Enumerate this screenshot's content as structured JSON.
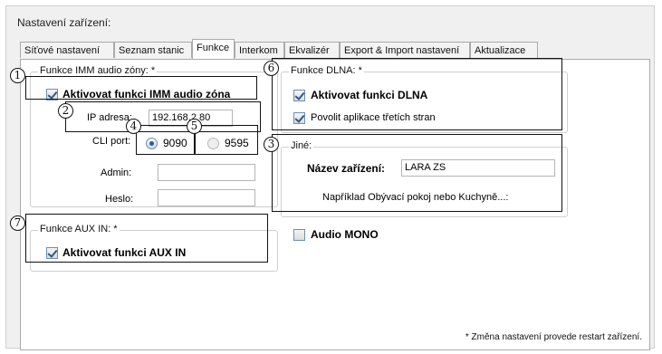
{
  "group": {
    "title": "Nastavení zařízení:"
  },
  "tabs": [
    {
      "label": "Síťové nastavení"
    },
    {
      "label": "Seznam stanic"
    },
    {
      "label": "Funkce"
    },
    {
      "label": "Interkom"
    },
    {
      "label": "Ekvalizér"
    },
    {
      "label": "Export & Import nastavení"
    },
    {
      "label": "Aktualizace"
    }
  ],
  "active_tab": "Funkce",
  "imm": {
    "legend": "Funkce IMM audio zóny: *",
    "enable_label": "Aktivovat funkci IMM audio zóna",
    "enable_checked": true,
    "ip_label": "IP adresa:",
    "ip_value": "192.168.2.80",
    "cli_label": "CLI port:",
    "port_options": [
      {
        "label": "9090",
        "selected": true
      },
      {
        "label": "9595",
        "selected": false
      }
    ],
    "admin_label": "Admin:",
    "admin_value": "",
    "password_label": "Heslo:",
    "password_value": ""
  },
  "dlna": {
    "legend": "Funkce DLNA: *",
    "enable_label": "Aktivovat funkci DLNA",
    "enable_checked": true,
    "third_party_label": "Povolit aplikace třetích stran",
    "third_party_checked": true
  },
  "other": {
    "legend": "Jiné:",
    "device_name_label": "Název zařízení:",
    "device_name_value": "LARA ZS",
    "example_text": "Například Obývací pokoj nebo Kuchyně...:"
  },
  "aux": {
    "legend": "Funkce AUX IN: *",
    "enable_label": "Aktivovat funkci AUX IN",
    "enable_checked": true
  },
  "audio_mono": {
    "label": "Audio MONO",
    "checked": false
  },
  "footer_note": "* Změna nastavení provede restart zařízení.",
  "callout_numbers": [
    "1",
    "2",
    "3",
    "4",
    "5",
    "6",
    "7"
  ]
}
